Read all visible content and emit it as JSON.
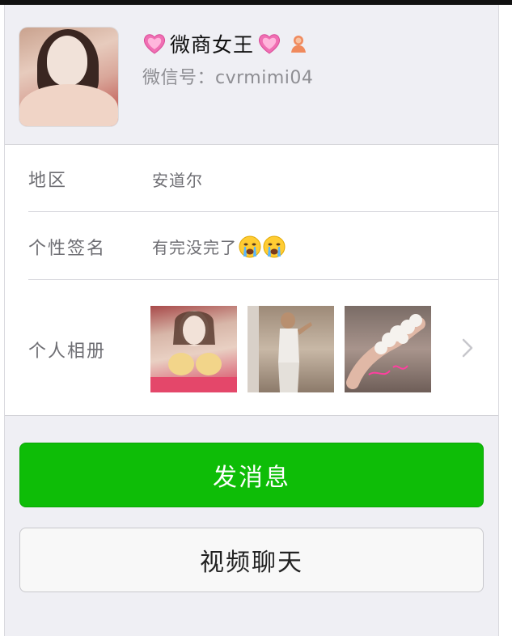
{
  "profile": {
    "name": "微商女王",
    "wechat_id": "微信号：cvrmimi04"
  },
  "details": {
    "region_label": "地区",
    "region_value": "安道尔",
    "signature_label": "个性签名",
    "signature_value": "有完没完了",
    "album_label": "个人相册"
  },
  "actions": {
    "message_label": "发消息",
    "video_label": "视频聊天"
  },
  "colors": {
    "primary_green": "#0ebd07",
    "background": "#efeff4"
  },
  "icons": [
    "heart-icon",
    "gender-female-icon",
    "crying-face-icon",
    "chevron-right-icon"
  ]
}
